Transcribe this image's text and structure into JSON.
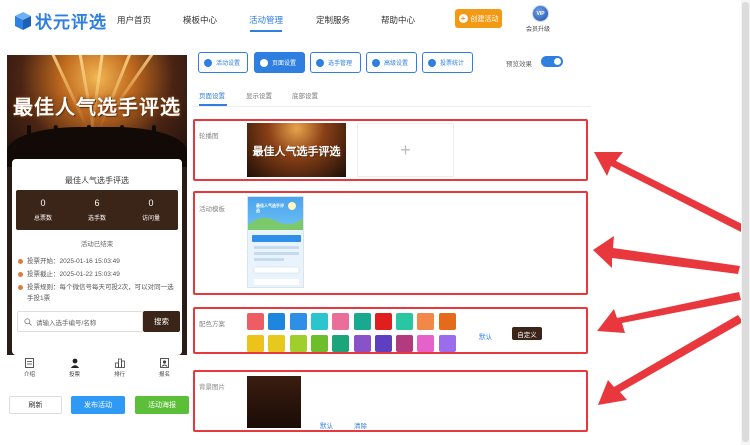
{
  "brand": {
    "name": "状元评选",
    "color": "#2f7fe0"
  },
  "nav": {
    "items": [
      {
        "label": "用户首页"
      },
      {
        "label": "模板中心"
      },
      {
        "label": "活动管理",
        "active": true
      },
      {
        "label": "定制服务"
      },
      {
        "label": "帮助中心"
      }
    ],
    "create_button": "创建活动",
    "vip_badge": "VIP",
    "vip_label": "会员升级"
  },
  "preview": {
    "banner_title": "最佳人气选手评选",
    "card_title": "最佳人气选手评选",
    "stats": [
      {
        "value": "0",
        "label": "总票数"
      },
      {
        "value": "6",
        "label": "选手数"
      },
      {
        "value": "0",
        "label": "访问量"
      }
    ],
    "status": "活动已结束",
    "info": [
      "投票开始：2025-01-16 15:03:49",
      "投票截止：2025-01-22 15:03:49",
      "投票规则：每个微信号每天可投2次，可以对同一选手投1票"
    ],
    "search_placeholder": "请输入选手编号/名称",
    "search_button": "搜索",
    "tabs": [
      {
        "label": "介绍",
        "icon": "document-icon"
      },
      {
        "label": "投票",
        "icon": "user-icon"
      },
      {
        "label": "排行",
        "icon": "ranking-icon"
      },
      {
        "label": "报名",
        "icon": "signup-icon"
      }
    ]
  },
  "actions": {
    "refresh": "刷新",
    "publish": "发布活动",
    "poster": "活动海报"
  },
  "toolbar": {
    "buttons": [
      {
        "label": "活动设置",
        "icon": "gear-icon"
      },
      {
        "label": "页面设置",
        "icon": "gear-icon",
        "active": true
      },
      {
        "label": "选手管理",
        "icon": "users-icon"
      },
      {
        "label": "高级设置",
        "icon": "sliders-icon"
      },
      {
        "label": "投票统计",
        "icon": "chart-icon"
      }
    ],
    "preview_label": "预览效果",
    "preview_on": true
  },
  "subtabs": [
    {
      "label": "页面设置",
      "active": true
    },
    {
      "label": "显示设置"
    },
    {
      "label": "底部设置"
    }
  ],
  "sections": {
    "carousel": {
      "label": "轮播图",
      "image_title": "最佳人气选手评选"
    },
    "template": {
      "label": "活动模板",
      "thumb_title": "最佳人气选手评选"
    },
    "color_scheme": {
      "label": "配色方案",
      "colors_row1": [
        "#ee5d63",
        "#1f86e0",
        "#2f8ee8",
        "#2bc5cf",
        "#ea6e9a",
        "#19a98e",
        "#e01e1e",
        "#29c6a3",
        "#f2874a",
        "#e36b1a"
      ],
      "colors_row2": [
        "#ecc21b",
        "#e7c81e",
        "#9fcf2a",
        "#6cbf2a",
        "#1aa67a",
        "#8a52c9",
        "#5e3fbf",
        "#b33a7e",
        "#e462c9",
        "#9b6ded"
      ],
      "default_label": "默认",
      "custom_label": "自定义"
    },
    "background": {
      "label": "背景图片",
      "default_link": "默认",
      "clear_link": "清除"
    }
  },
  "colors": {
    "accent": "#2f7fe0",
    "orange": "#f39a14",
    "brown": "#3b2418",
    "highlight": "#e8383d",
    "green": "#5cbf3a"
  }
}
